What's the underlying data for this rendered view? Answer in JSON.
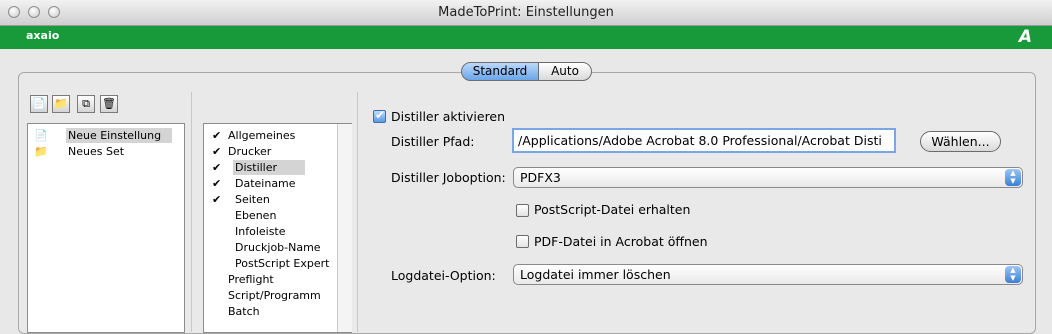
{
  "window": {
    "title": "MadeToPrint:  Einstellungen"
  },
  "brand": {
    "name": "axaio",
    "mark": "A"
  },
  "tabs": {
    "standard": "Standard",
    "auto": "Auto"
  },
  "toolbar": {
    "new_icon": "📄",
    "folder_icon": "📁",
    "copy_icon": "⧉",
    "delete_icon": "🗑"
  },
  "settings_list": [
    {
      "label": "Neue Einstellung",
      "icon": "📄",
      "selected": true
    },
    {
      "label": "Neues Set",
      "icon": "📁",
      "selected": false
    }
  ],
  "categories": [
    {
      "label": "Allgemeines",
      "check": "✔",
      "indent": 0
    },
    {
      "label": "Drucker",
      "check": "✔",
      "indent": 0
    },
    {
      "label": "Distiller",
      "check": "✔",
      "indent": 1,
      "selected": true
    },
    {
      "label": "Dateiname",
      "check": "✔",
      "indent": 1
    },
    {
      "label": "Seiten",
      "check": "✔",
      "indent": 1
    },
    {
      "label": "Ebenen",
      "check": "",
      "indent": 1
    },
    {
      "label": "Infoleiste",
      "check": "",
      "indent": 1
    },
    {
      "label": "Druckjob-Name",
      "check": "",
      "indent": 1
    },
    {
      "label": "PostScript Expert",
      "check": "",
      "indent": 1
    },
    {
      "label": "Preflight",
      "check": "",
      "indent": 0
    },
    {
      "label": "Script/Programm",
      "check": "",
      "indent": 0
    },
    {
      "label": "Batch",
      "check": "",
      "indent": 0
    }
  ],
  "distiller": {
    "activate_label": "Distiller aktivieren",
    "path_label": "Distiller Pfad:",
    "path_value": "/Applications/Adobe Acrobat 8.0 Professional/Acrobat Disti",
    "choose_button": "Wählen...",
    "joboption_label": "Distiller Joboption:",
    "joboption_value": "PDFX3",
    "keep_ps_label": "PostScript-Datei erhalten",
    "open_pdf_label": "PDF-Datei in Acrobat öffnen",
    "logfile_label": "Logdatei-Option:",
    "logfile_value": "Logdatei immer löschen"
  },
  "colors": {
    "brand_green": "#199a3a",
    "selection_blue": "#6aa6ea"
  }
}
